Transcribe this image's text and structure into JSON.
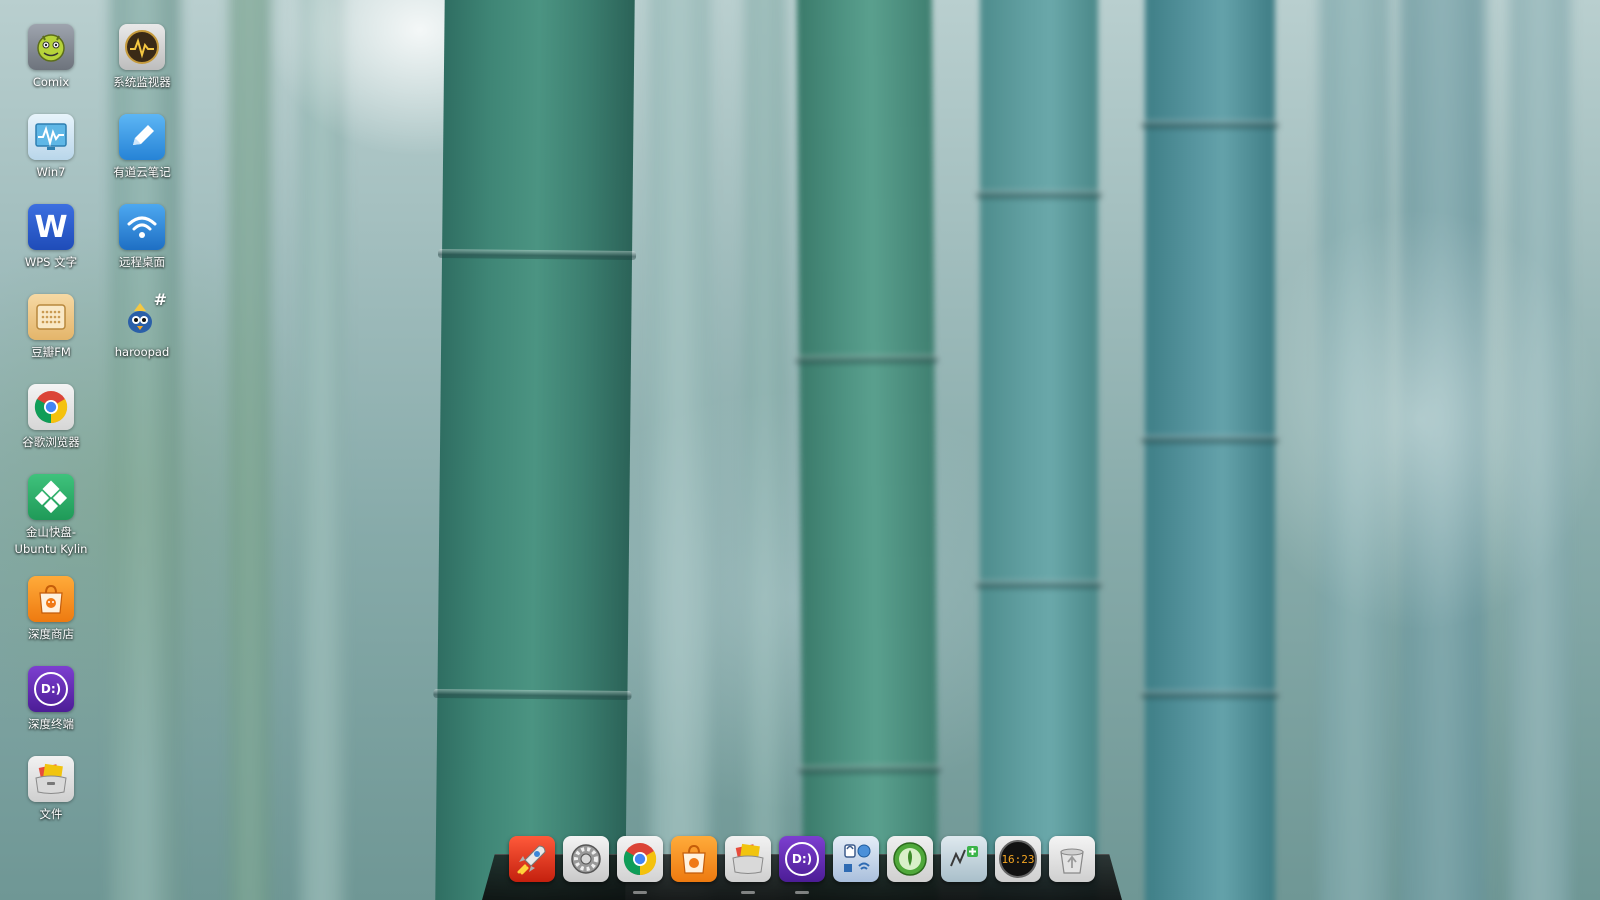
{
  "desktop": {
    "icons": [
      {
        "name": "comix",
        "label": "Comix",
        "icon": "comix-face-icon"
      },
      {
        "name": "system-monitor",
        "label": "系统监视器",
        "icon": "system-monitor-icon"
      },
      {
        "name": "win7",
        "label": "Win7",
        "icon": "monitor-wave-icon"
      },
      {
        "name": "youdao-note",
        "label": "有道云笔记",
        "icon": "pencil-note-icon"
      },
      {
        "name": "wps-writer",
        "label": "WPS 文字",
        "icon": "wps-w-icon",
        "glyph": "W"
      },
      {
        "name": "remote-desktop",
        "label": "远程桌面",
        "icon": "wifi-icon"
      },
      {
        "name": "douban-fm",
        "label": "豆瓣FM",
        "icon": "radio-icon"
      },
      {
        "name": "haroopad",
        "label": "haroopad",
        "icon": "haroopad-bird-icon",
        "glyph": "#"
      },
      {
        "name": "chrome",
        "label": "谷歌浏览器",
        "icon": "chrome-icon"
      },
      {
        "name": "kingsoft-kuaipan",
        "label": "金山快盘-Ubuntu Kylin",
        "icon": "kuaipan-icon"
      },
      {
        "name": "deepin-store",
        "label": "深度商店",
        "icon": "store-bag-icon"
      },
      {
        "name": "deepin-terminal",
        "label": "深度终端",
        "icon": "terminal-icon",
        "glyph": "D:)"
      },
      {
        "name": "files",
        "label": "文件",
        "icon": "file-manager-icon"
      }
    ]
  },
  "dock": {
    "items": [
      {
        "name": "launcher",
        "icon": "rocket-icon"
      },
      {
        "name": "system-settings",
        "icon": "settings-gear-icon"
      },
      {
        "name": "chrome",
        "icon": "chrome-icon"
      },
      {
        "name": "deepin-store",
        "icon": "store-bag-icon"
      },
      {
        "name": "files",
        "icon": "file-manager-icon"
      },
      {
        "name": "deepin-terminal",
        "icon": "terminal-icon",
        "glyph": "D:)"
      },
      {
        "name": "control-center",
        "icon": "control-center-icon"
      },
      {
        "name": "music-player",
        "icon": "music-player-icon"
      },
      {
        "name": "system-monitor",
        "icon": "system-monitor-chart-icon"
      },
      {
        "name": "clock",
        "icon": "clock-icon",
        "time": "16:23"
      },
      {
        "name": "trash",
        "icon": "trash-recycle-icon"
      }
    ]
  },
  "colors": {
    "label_text": "#ffffff",
    "dock_bg": "#141414"
  }
}
